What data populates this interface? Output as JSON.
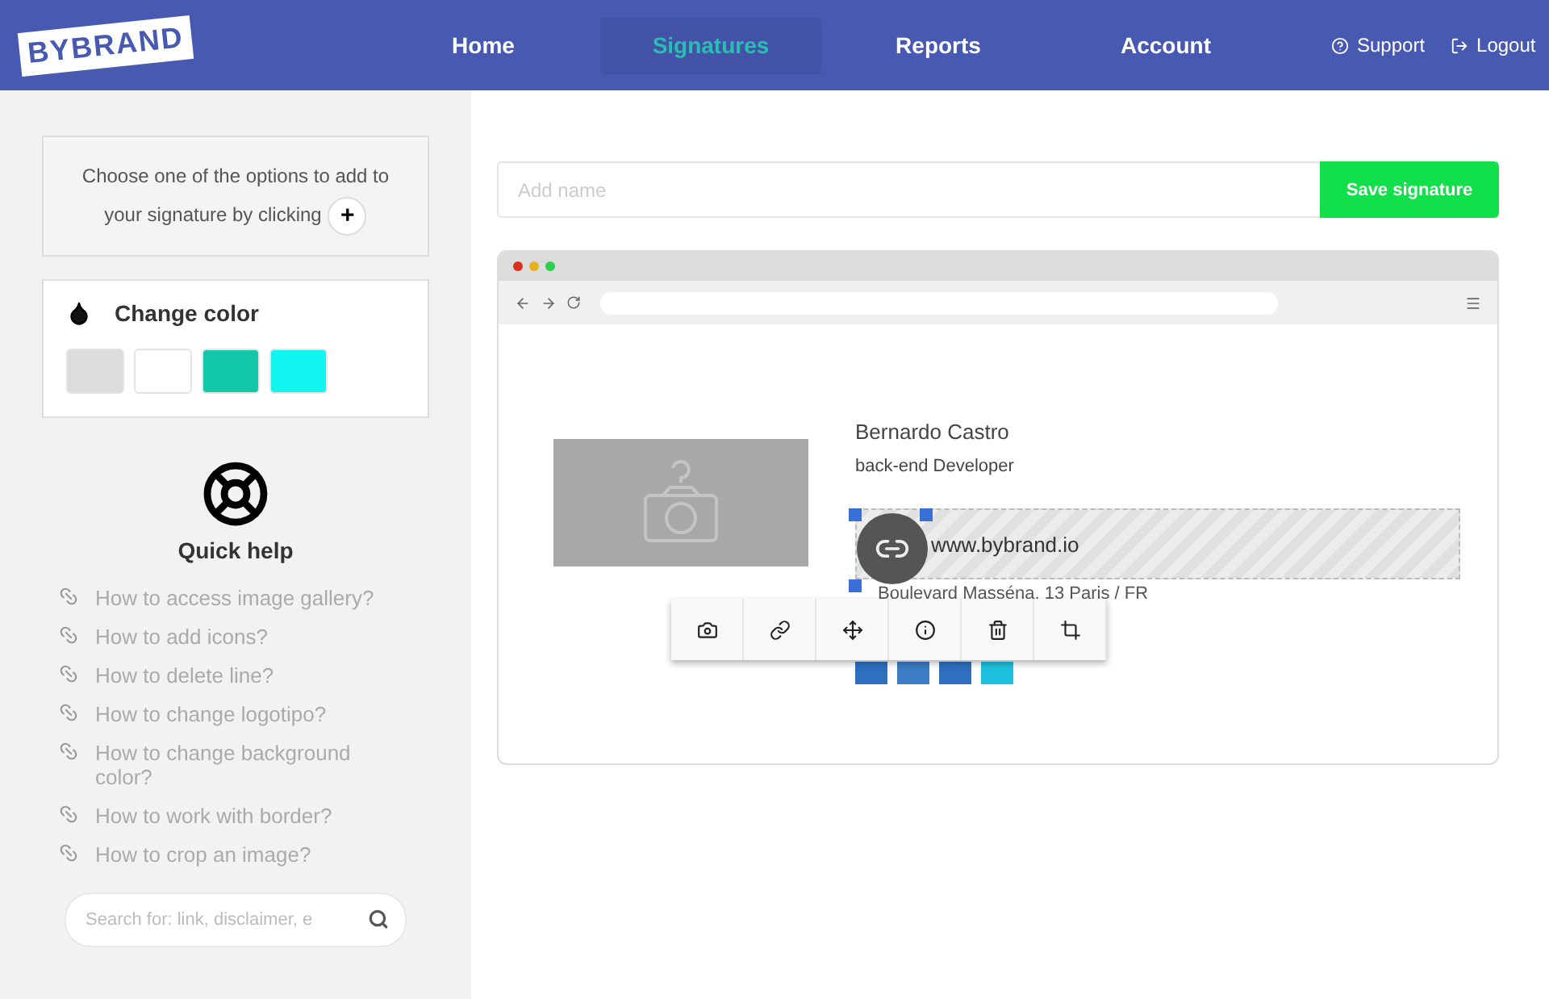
{
  "header": {
    "logo": "BYBRAND",
    "nav": [
      {
        "label": "Home",
        "selected": false
      },
      {
        "label": "Signatures",
        "selected": true
      },
      {
        "label": "Reports",
        "selected": false
      },
      {
        "label": "Account",
        "selected": false
      }
    ],
    "support": "Support",
    "logout": "Logout"
  },
  "sidebar": {
    "hint": {
      "text": "Choose one of the options to add to your signature by clicking",
      "button": "+"
    },
    "change_color": {
      "title": "Change color",
      "swatches": [
        {
          "color": "#dcdcdc"
        },
        {
          "color": "#ffffff"
        },
        {
          "color": "#12c8a8"
        },
        {
          "color": "#10f5f0"
        }
      ]
    },
    "quick_help": {
      "title": "Quick help",
      "links": [
        "How to access image gallery?",
        "How to add icons?",
        "How to delete line?",
        "How to change logotipo?",
        "How to change background color?",
        "How to work with border?",
        "How to crop an image?"
      ]
    },
    "search": {
      "placeholder": "Search for: link, disclaimer, e"
    }
  },
  "editor": {
    "name_field": {
      "placeholder": "Add name"
    },
    "save_button": "Save signature",
    "signature": {
      "name": "Bernardo Castro",
      "role": "back-end Developer",
      "website": "www.bybrand.io",
      "address": "Boulevard Masséna, 13 Paris / FR",
      "social": [
        {
          "color": "#2f6fc0"
        },
        {
          "color": "#3b7cc4"
        },
        {
          "color": "#2f6fc0"
        },
        {
          "color": "#1ec0e0"
        }
      ]
    }
  }
}
